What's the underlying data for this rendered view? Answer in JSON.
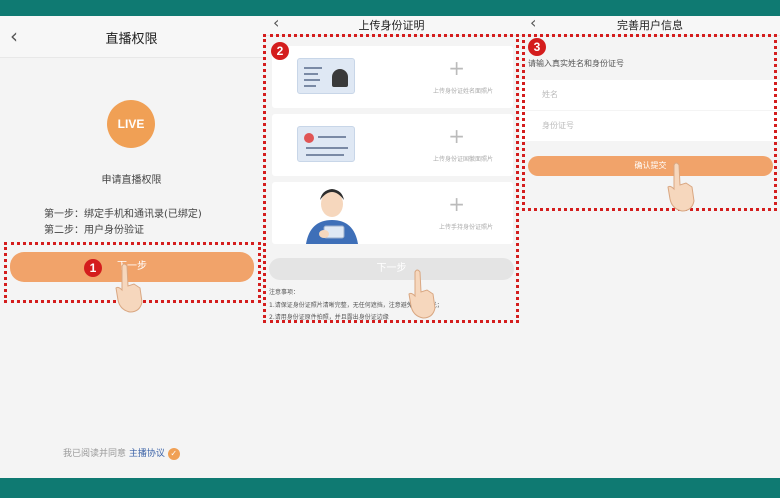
{
  "panel1": {
    "back_icon": "chevron-left-icon",
    "title": "直播权限",
    "live_badge": "LIVE",
    "apply_text": "申请直播权限",
    "step1": "第一步：绑定手机和通讯录(已绑定)",
    "step2": "第二步：用户身份验证",
    "next_button": "下一步",
    "agree_text": "我已阅读并同意",
    "agreement_link": "主播协议"
  },
  "panel2": {
    "back_icon": "chevron-left-icon",
    "title": "上传身份证明",
    "cards": [
      {
        "label": "上传身份证姓名面照片",
        "icon": "id-card-front-icon"
      },
      {
        "label": "上传身份证国徽面照片",
        "icon": "id-card-back-icon"
      },
      {
        "label": "上传手持身份证照片",
        "icon": "person-holding-id-icon"
      }
    ],
    "next_button": "下一步",
    "notes_title": "注意事项：",
    "note1": "1.请保证身份证照片清晰完整，无任何遮挡，注意避免照片反光；",
    "note2": "2.请用身份证原件拍照，并且露出身份证边缘"
  },
  "panel3": {
    "back_icon": "chevron-left-icon",
    "title": "完善用户信息",
    "prompt": "请输入真实姓名和身份证号",
    "name_placeholder": "姓名",
    "id_placeholder": "身份证号",
    "confirm_button": "确认提交"
  },
  "annotations": [
    "1",
    "2",
    "3"
  ],
  "colors": {
    "background": "#0f7a72",
    "accent": "#f1a36a",
    "annotation": "#d41d1d",
    "link": "#3d64a8"
  }
}
